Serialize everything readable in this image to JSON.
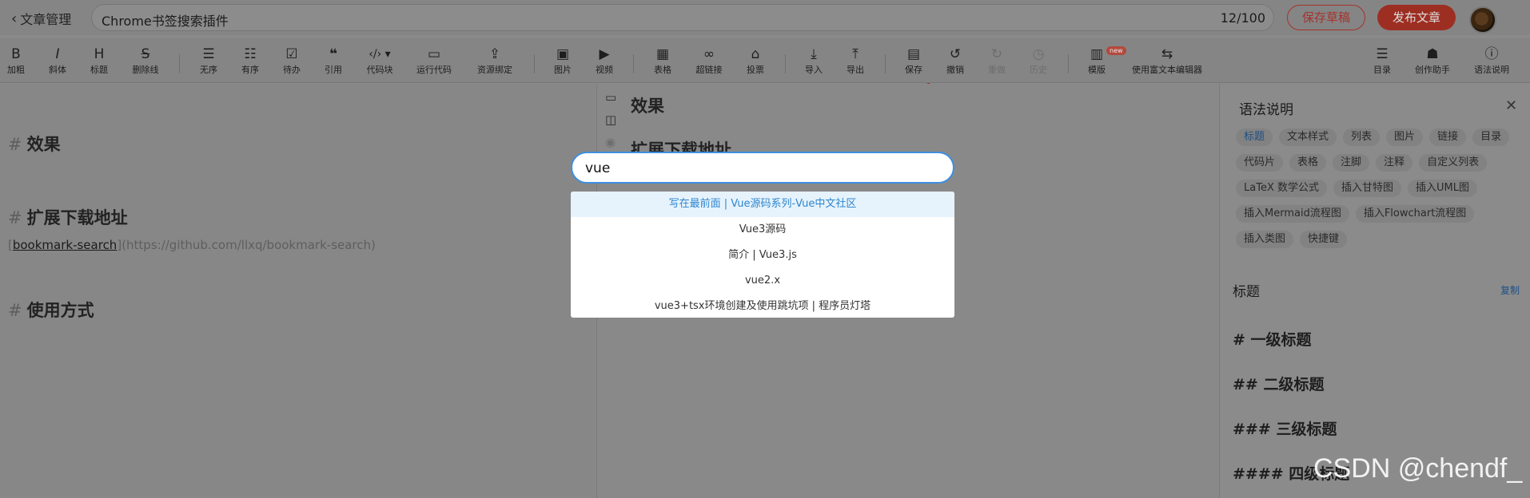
{
  "header": {
    "back_label": "文章管理",
    "title": "Chrome书签搜索插件",
    "title_count": "12/100",
    "save_draft": "保存草稿",
    "publish": "发布文章"
  },
  "toolbar": {
    "bold": "加粗",
    "italic": "斜体",
    "heading": "标题",
    "strike": "删除线",
    "ul": "无序",
    "ol": "有序",
    "todo": "待办",
    "quote": "引用",
    "codeblock": "代码块",
    "run_code": "运行代码",
    "resource": "资源绑定",
    "image": "图片",
    "video": "视频",
    "table": "表格",
    "link": "超链接",
    "vote": "投票",
    "import": "导入",
    "export": "导出",
    "save": "保存",
    "undo": "撤销",
    "redo": "重做",
    "history": "历史",
    "template": "模版",
    "template_badge": "new",
    "rich_editor": "使用富文本编辑器",
    "toc": "目录",
    "assistant": "创作助手",
    "syntax": "语法说明"
  },
  "editor": {
    "h1": "效果",
    "h2": "扩展下载地址",
    "link_text": "bookmark-search",
    "link_url": "(https://github.com/llxq/bookmark-search)",
    "h3": "使用方式",
    "hash": "#"
  },
  "preview": {
    "h1": "效果",
    "h2": "扩展下载地址"
  },
  "search": {
    "value": "vue",
    "results": [
      "写在最前面 | Vue源码系列-Vue中文社区",
      "Vue3源码",
      "简介 | Vue3.js",
      "vue2.x",
      "vue3+tsx环境创建及使用跳坑项 | 程序员灯塔"
    ]
  },
  "sidebar": {
    "title": "语法说明",
    "tags": [
      "标题",
      "文本样式",
      "列表",
      "图片",
      "链接",
      "目录",
      "代码片",
      "表格",
      "注脚",
      "注释",
      "自定义列表",
      "LaTeX 数学公式",
      "插入甘特图",
      "插入UML图",
      "插入Mermaid流程图",
      "插入Flowchart流程图",
      "插入类图",
      "快捷键"
    ],
    "section_title": "标题",
    "copy": "复制",
    "examples": [
      "# 一级标题",
      "## 二级标题",
      "### 三级标题",
      "#### 四级标题"
    ]
  },
  "watermark": "CSDN @chendf_",
  "colors": {
    "accent_red": "#c9392b",
    "link_blue": "#3d8fe0",
    "active_bg": "#e6f3fc"
  }
}
